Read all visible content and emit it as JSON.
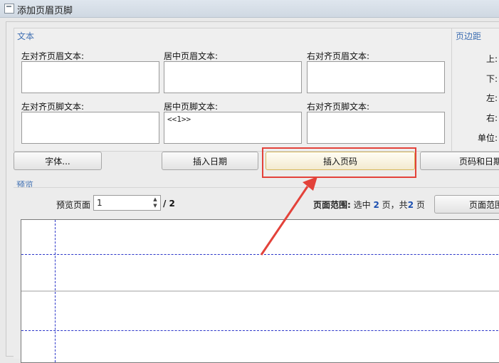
{
  "window": {
    "title": "添加页眉页脚"
  },
  "text_group": {
    "title": "文本",
    "header_left_label": "左对齐页眉文本:",
    "header_center_label": "居中页眉文本:",
    "header_right_label": "右对齐页眉文本:",
    "footer_left_label": "左对齐页脚文本:",
    "footer_center_label": "居中页脚文本:",
    "footer_right_label": "右对齐页脚文本:",
    "header_left_value": "",
    "header_center_value": "",
    "header_right_value": "",
    "footer_left_value": "",
    "footer_center_value": "<<1>>",
    "footer_right_value": ""
  },
  "margin_group": {
    "title": "页边距",
    "top": "上:",
    "bottom": "下:",
    "left": "左:",
    "right": "右:",
    "unit": "单位:"
  },
  "buttons": {
    "font": "字体...",
    "insert_date": "插入日期",
    "insert_page_number": "插入页码",
    "page_and_date": "页码和日期"
  },
  "preview": {
    "title": "预览",
    "page_label": "预览页面",
    "page_value": "1",
    "page_total": "/ 2",
    "range_label": "页面范围:",
    "range_text_a": "选中",
    "range_selected": "2",
    "range_text_b": "页，共",
    "range_total": "2",
    "range_text_c": "页",
    "range_button": "页面范围"
  },
  "colors": {
    "group_title": "#3f6fb2",
    "highlight_border": "#e3423a",
    "guide_lines": "#2b36c9"
  }
}
